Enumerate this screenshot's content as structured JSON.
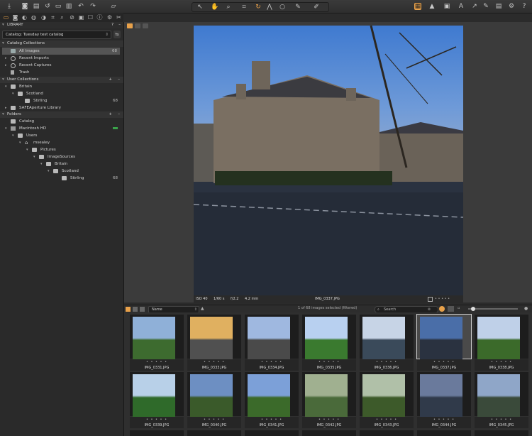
{
  "toolbar": {
    "left_icons": [
      "import-icon",
      "camera-icon",
      "share-icon",
      "folder-open-icon",
      "trash-icon",
      "rotate-icon",
      "undo-icon",
      "redo-icon",
      "copy-icon"
    ],
    "center_tools": [
      "pointer-tool-icon",
      "pan-tool-icon",
      "loupe-tool-icon",
      "crop-tool-icon",
      "rotate-tool-icon",
      "keystone-tool-icon",
      "spot-tool-icon",
      "brush-tool-icon",
      "picker-tool-icon"
    ],
    "right_icons": [
      "grid-view-icon",
      "warning-icon",
      "compare-icon",
      "text-overlay-icon",
      "cursor-icon",
      "edit-icon",
      "print-icon",
      "gear-icon",
      "help-icon"
    ]
  },
  "library": {
    "title": "LIBRARY",
    "catalog_select": "Catalog: Tuesday test catalog",
    "catalog_collections": {
      "heading": "Catalog Collections",
      "items": [
        {
          "label": "All Images",
          "count": "68"
        },
        {
          "label": "Recent Imports",
          "count": ""
        },
        {
          "label": "Recent Captures",
          "count": ""
        },
        {
          "label": "Trash",
          "count": ""
        }
      ]
    },
    "user_collections": {
      "heading": "User Collections",
      "items": [
        {
          "label": "Britain",
          "count": ""
        },
        {
          "label": "Scotland",
          "count": ""
        },
        {
          "label": "Stirling",
          "count": "68"
        },
        {
          "label": "SAFEAperture Library",
          "count": ""
        }
      ]
    },
    "folders": {
      "heading": "Folders",
      "items": [
        {
          "label": "Catalog",
          "count": ""
        },
        {
          "label": "Macintosh HD",
          "count": ""
        },
        {
          "label": "Users",
          "count": ""
        },
        {
          "label": "msealey",
          "count": ""
        },
        {
          "label": "Pictures",
          "count": ""
        },
        {
          "label": "ImageSources",
          "count": ""
        },
        {
          "label": "Britain",
          "count": ""
        },
        {
          "label": "Scotland",
          "count": ""
        },
        {
          "label": "Stirling",
          "count": "68"
        }
      ]
    }
  },
  "viewer": {
    "iso": "ISO 40",
    "shutter": "1/60 s",
    "aperture": "f/2.2",
    "focal": "4.2 mm",
    "filename": "IMG_0337.JPG",
    "rating_dots": "• • • • •"
  },
  "filmstrip": {
    "sort": "Name",
    "status": "1 of 68 images selected (filtered)",
    "search_placeholder": "Search",
    "row1": [
      "IMG_0331.JPG",
      "IMG_0333.JPG",
      "IMG_0334.JPG",
      "IMG_0335.JPG",
      "IMG_0336.JPG",
      "IMG_0337.JPG",
      "IMG_0338.JPG"
    ],
    "row2": [
      "IMG_0339.JPG",
      "IMG_0340.JPG",
      "IMG_0341.JPG",
      "IMG_0342.JPG",
      "IMG_0343.JPG",
      "IMG_0344.JPG",
      "IMG_0345.JPG"
    ],
    "selected_index": 5
  },
  "colors": {
    "accent": "#e8a14a",
    "selection": "#5a5a5a",
    "badge_green": "#3aa34a"
  }
}
